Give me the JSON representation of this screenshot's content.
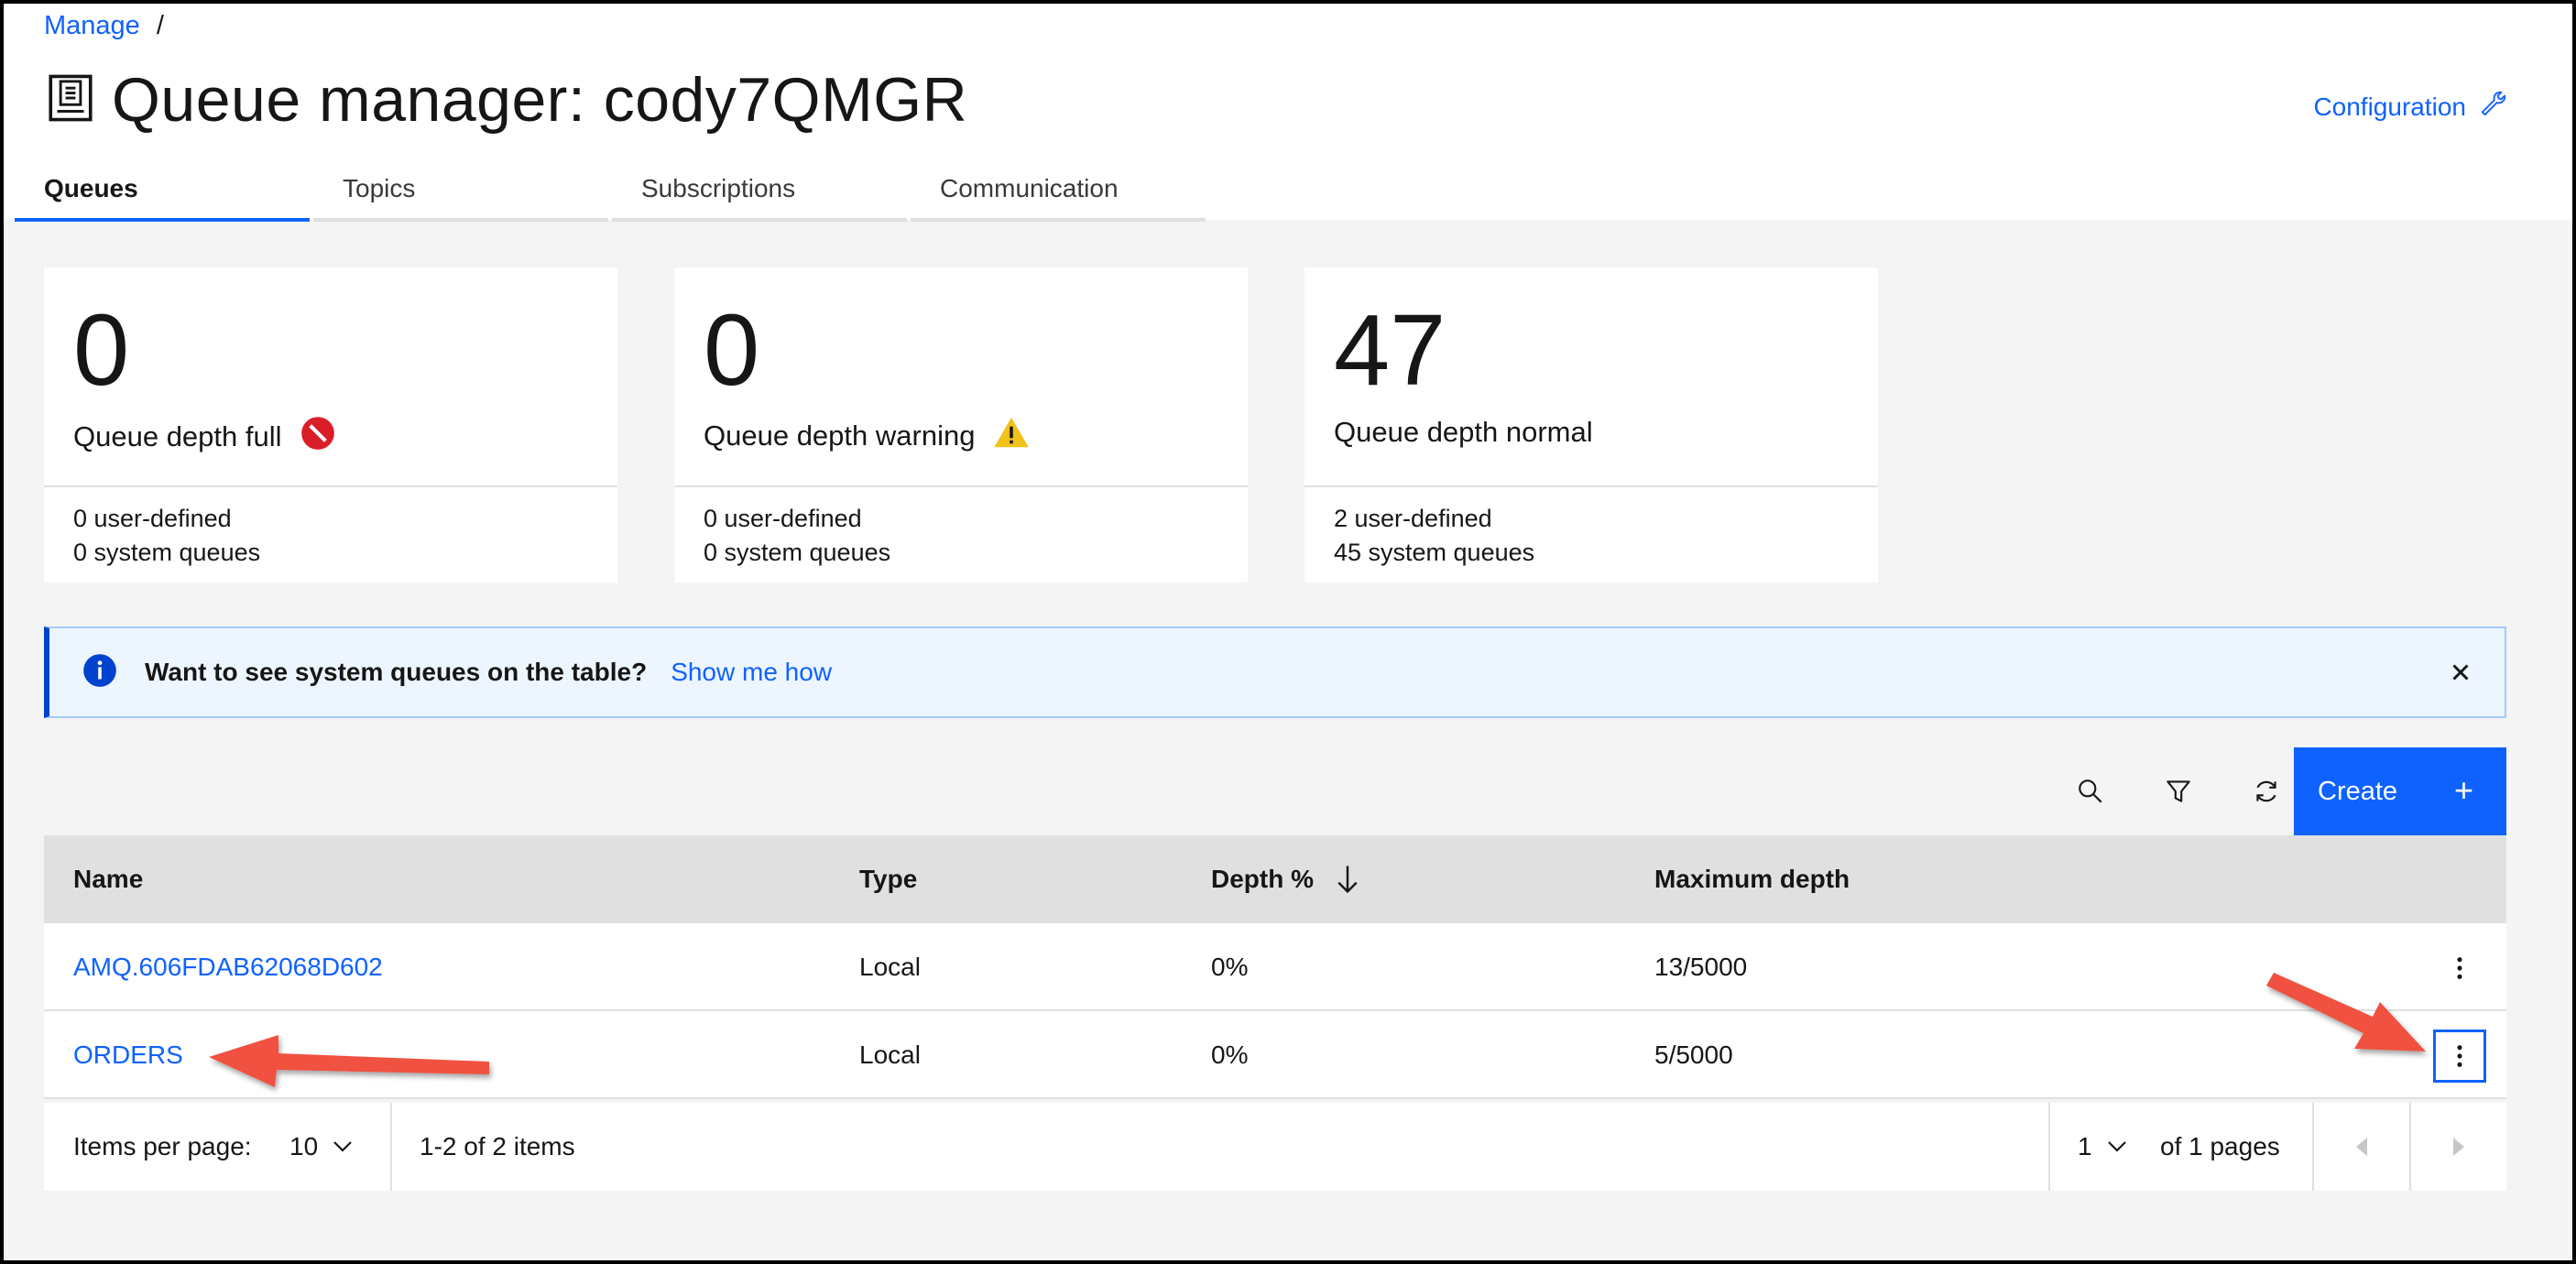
{
  "breadcrumb": {
    "link": "Manage",
    "separator": "/"
  },
  "header": {
    "title": "Queue manager: cody7QMGR",
    "config_label": "Configuration"
  },
  "tabs": [
    {
      "label": "Queues",
      "active": true
    },
    {
      "label": "Topics",
      "active": false
    },
    {
      "label": "Subscriptions",
      "active": false
    },
    {
      "label": "Communication",
      "active": false
    }
  ],
  "cards": [
    {
      "count": "0",
      "label": "Queue depth full",
      "status_icon": "blocked-icon",
      "user_defined": "0  user-defined",
      "system": "0  system queues"
    },
    {
      "count": "0",
      "label": "Queue depth warning",
      "status_icon": "warning-icon",
      "user_defined": "0  user-defined",
      "system": "0  system queues"
    },
    {
      "count": "47",
      "label": "Queue depth normal",
      "status_icon": "",
      "user_defined": "2  user-defined",
      "system": "45  system queues"
    }
  ],
  "banner": {
    "message": "Want to see system queues on the table?",
    "link": "Show me how"
  },
  "toolbar": {
    "create_label": "Create",
    "create_icon": "+"
  },
  "table": {
    "columns": [
      "Name",
      "Type",
      "Depth %",
      "Maximum depth"
    ],
    "sort_icon": "arrow-down-icon",
    "rows": [
      {
        "name": "AMQ.606FDAB62068D602",
        "type": "Local",
        "depth": "0%",
        "max": "13/5000"
      },
      {
        "name": "ORDERS",
        "type": "Local",
        "depth": "0%",
        "max": "5/5000"
      }
    ]
  },
  "pagination": {
    "items_per_page_label": "Items per page:",
    "items_per_page": "10",
    "range": "1-2 of 2 items",
    "page": "1",
    "of_pages": "of 1 pages"
  },
  "colors": {
    "accent": "#0f62fe",
    "danger": "#da1e28",
    "warning": "#f1c21b",
    "annotation": "#f0513f"
  }
}
